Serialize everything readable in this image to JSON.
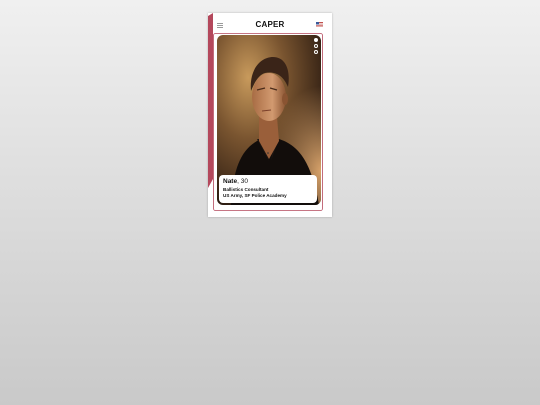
{
  "app": {
    "title": "CAPER",
    "accent_color": "#b4485c",
    "background_colors": [
      "#f0f0f0",
      "#c9c9c9"
    ]
  },
  "header": {
    "menu_icon": "hamburger-menu-icon",
    "title": "CAPER",
    "flag_icon": "us-flag-icon"
  },
  "profile": {
    "name": "Nate",
    "age_text": ", 30",
    "job": "Ballistics Consultant",
    "school": "US Army, SF Police Academy",
    "photo_count": 3,
    "active_photo": 1
  }
}
